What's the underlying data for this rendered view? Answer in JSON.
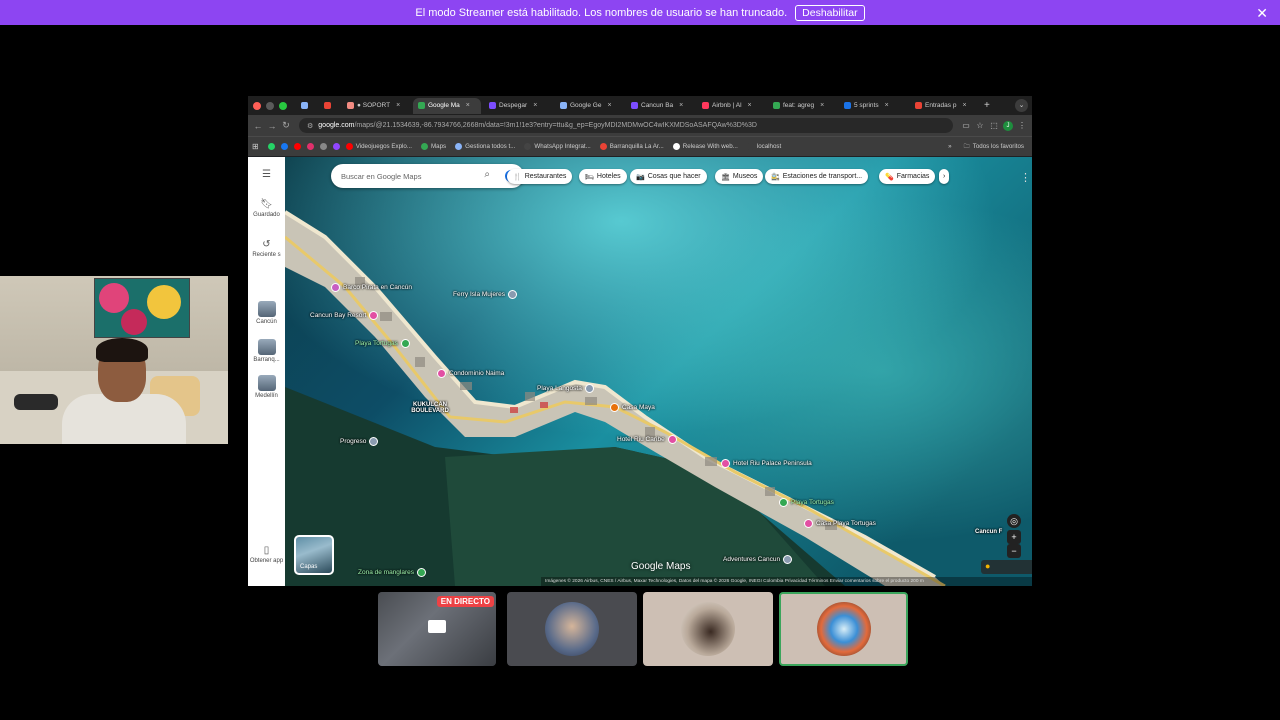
{
  "banner": {
    "message": "El modo Streamer está habilitado. Los nombres de usuario se han truncado.",
    "button": "Deshabilitar",
    "close_icon": "close-icon",
    "background": "#8d45f2"
  },
  "browser": {
    "tabs": [
      {
        "label": "",
        "icon_color": "#8ab4f8"
      },
      {
        "label": "",
        "icon_color": "#ea4335"
      },
      {
        "label": "● SOPORT",
        "icon_color": "#f28b82"
      },
      {
        "label": "Google Ma",
        "icon_color": "#34a853",
        "active": true
      },
      {
        "label": "Despegar",
        "icon_color": "#7c4dff"
      },
      {
        "label": "Google Ge",
        "icon_color": "#8ab4f8"
      },
      {
        "label": "Cancun Ba",
        "icon_color": "#7c4dff"
      },
      {
        "label": "Airbnb | Al",
        "icon_color": "#ff385c"
      },
      {
        "label": "feat: agreg",
        "icon_color": "#34a853"
      },
      {
        "label": "5 sprints",
        "icon_color": "#1a73e8"
      },
      {
        "label": "Entradas p",
        "icon_color": "#ea4335"
      }
    ],
    "new_tab": "+",
    "url_host": "google.com",
    "url_rest": "/maps/@21.1534639,-86.7934766,2668m/data=!3m1!1e3?entry=ttu&g_ep=EgoyMDI2MDMwOC4wIKXMDSoASAFQAw%3D%3D",
    "bookmarks": [
      {
        "label": "",
        "color": "#25d366"
      },
      {
        "label": "",
        "color": "#1877f2"
      },
      {
        "label": "",
        "color": "#ff0000"
      },
      {
        "label": "",
        "color": "#e1306c"
      },
      {
        "label": "",
        "color": "#888888"
      },
      {
        "label": "",
        "color": "#9146ff"
      },
      {
        "label": "Videojuegos Explo...",
        "color": "#ff0000"
      },
      {
        "label": "Maps",
        "color": "#34a853"
      },
      {
        "label": "Gestiona todos t...",
        "color": "#8ab4f8"
      },
      {
        "label": "WhatsApp Integrat...",
        "color": "#444444"
      },
      {
        "label": "Barranquilla La Ar...",
        "color": "#ea4335"
      },
      {
        "label": "Release With web...",
        "color": "#ffffff"
      },
      {
        "label": "localhost",
        "color": "#3c3c3c"
      }
    ],
    "bookmarks_more": "»",
    "all_bookmarks": "Todos los favoritos"
  },
  "maps": {
    "sidebar": {
      "saved": "Guardado",
      "recents": "Reciente s",
      "places": [
        "Cancún",
        "Barranq...",
        "Medellín"
      ],
      "get_app": "Obtener app"
    },
    "search_placeholder": "Buscar en Google Maps",
    "chips": [
      {
        "label": "Restaurantes",
        "icon": "🍴"
      },
      {
        "label": "Hoteles",
        "icon": "🛏"
      },
      {
        "label": "Cosas que hacer",
        "icon": "📷"
      },
      {
        "label": "Museos",
        "icon": "🏛"
      },
      {
        "label": "Estaciones de transport...",
        "icon": "🚉"
      },
      {
        "label": "Farmacias",
        "icon": "💊"
      }
    ],
    "chip_more": "›",
    "avatar_letter": "J",
    "places": [
      {
        "name": "Barco Pirata en Cancún",
        "color": "#c75fc3"
      },
      {
        "name": "Ferry Isla Mujeres",
        "color": "#8a9bb0"
      },
      {
        "name": "Cancun Bay Resort",
        "color": "#e24fa3"
      },
      {
        "name": "Playa Tortugas",
        "color": "#34a853"
      },
      {
        "name": "Condominio Naima",
        "color": "#e24fa3"
      },
      {
        "name": "Playa Langosta",
        "color": "#8a9bb0"
      },
      {
        "name": "KUKULCAN BOULEVARD",
        "color": "#ffffff"
      },
      {
        "name": "Casa Maya",
        "color": "#e8710a"
      },
      {
        "name": "Progreso",
        "color": "#8a9bb0"
      },
      {
        "name": "Hotel Riu Caribe",
        "color": "#e24fa3"
      },
      {
        "name": "Hotel Riu Palace Peninsula",
        "color": "#e24fa3"
      },
      {
        "name": "Playa Tortugas",
        "color": "#34a853"
      },
      {
        "name": "Casa Playa Tortugas",
        "color": "#e24fa3"
      },
      {
        "name": "Adventures Cancun",
        "color": "#8a9bb0"
      },
      {
        "name": "Zona de manglares",
        "color": "#34a853"
      },
      {
        "name": "Cancun F",
        "color": "#e24fa3"
      }
    ],
    "layers_label": "Capas",
    "logo": "Google Maps",
    "attribution": "Imágenes © 2026 Airbus, CNES / Airbus, Maxar Technologies, Datos del mapa © 2026 Google, INEGI    Colombia    Privacidad    Términos    Enviar comentarios sobre el producto    200 m"
  },
  "participants": {
    "live_badge": "EN DIRECTO"
  }
}
